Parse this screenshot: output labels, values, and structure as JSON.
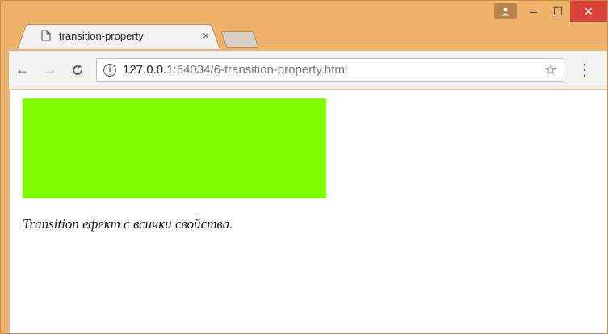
{
  "window": {
    "controls": {
      "minimize": "–",
      "maximize": "☐",
      "close": "✕"
    }
  },
  "tab": {
    "title": "transition-property",
    "close": "×"
  },
  "toolbar": {
    "back": "←",
    "forward": "→",
    "reload": "C",
    "url_host": "127.0.0.1",
    "url_rest": ":64034/6-transition-property.html",
    "star": "☆",
    "menu": "⋮"
  },
  "page": {
    "box_color": "#80ff00",
    "caption": "Transition ефект с всички свойства."
  }
}
